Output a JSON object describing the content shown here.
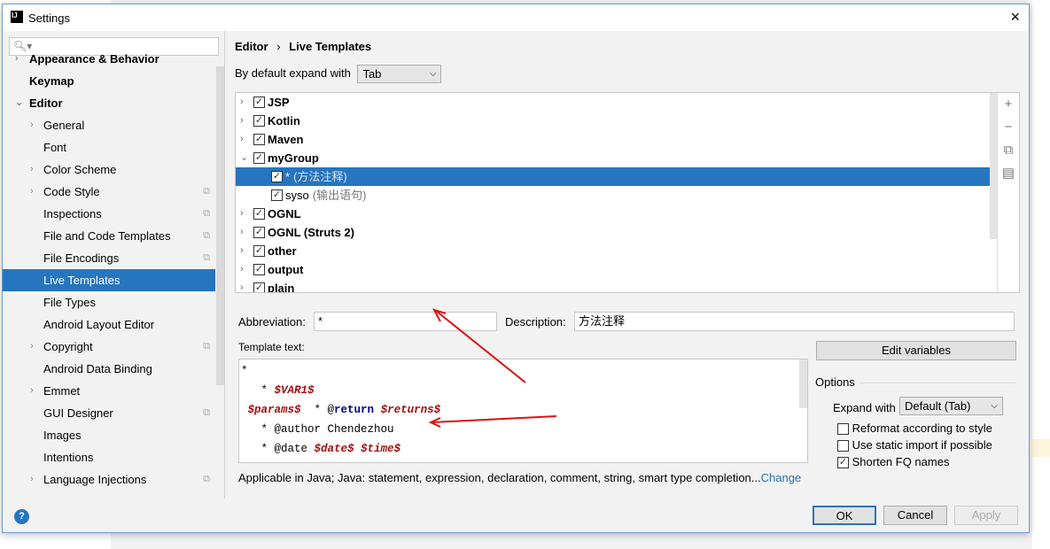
{
  "window": {
    "title": "Settings",
    "close_icon": "×"
  },
  "sidebar": {
    "search_placeholder": "",
    "items": [
      {
        "label": "Appearance & Behavior",
        "bold": true,
        "arrow": "›"
      },
      {
        "label": "Keymap",
        "bold": true
      },
      {
        "label": "Editor",
        "bold": true,
        "arrow": "⌄"
      },
      {
        "label": "General",
        "arrow": "›"
      },
      {
        "label": "Font"
      },
      {
        "label": "Color Scheme",
        "arrow": "›"
      },
      {
        "label": "Code Style",
        "arrow": "›",
        "copy": true
      },
      {
        "label": "Inspections",
        "copy": true
      },
      {
        "label": "File and Code Templates",
        "copy": true
      },
      {
        "label": "File Encodings",
        "copy": true
      },
      {
        "label": "Live Templates",
        "selected": true
      },
      {
        "label": "File Types"
      },
      {
        "label": "Android Layout Editor"
      },
      {
        "label": "Copyright",
        "arrow": "›",
        "copy": true
      },
      {
        "label": "Android Data Binding"
      },
      {
        "label": "Emmet",
        "arrow": "›"
      },
      {
        "label": "GUI Designer",
        "copy": true
      },
      {
        "label": "Images"
      },
      {
        "label": "Intentions"
      },
      {
        "label": "Language Injections",
        "arrow": "›",
        "copy": true
      }
    ]
  },
  "breadcrumb": {
    "parent": "Editor",
    "sep": "›",
    "current": "Live Templates"
  },
  "expand": {
    "label": "By default expand with",
    "value": "Tab"
  },
  "tree": [
    {
      "label": "JSP",
      "checked": true,
      "group": true,
      "expanded": false
    },
    {
      "label": "Kotlin",
      "checked": true,
      "group": true,
      "expanded": false
    },
    {
      "label": "Maven",
      "checked": true,
      "group": true,
      "expanded": false
    },
    {
      "label": "myGroup",
      "checked": true,
      "group": true,
      "expanded": true
    },
    {
      "label": "*",
      "desc": "(方法注释)",
      "checked": true,
      "selected": true
    },
    {
      "label": "syso",
      "desc": "(输出语句)",
      "checked": true
    },
    {
      "label": "OGNL",
      "checked": true,
      "group": true,
      "expanded": false
    },
    {
      "label": "OGNL (Struts 2)",
      "checked": true,
      "group": true,
      "expanded": false
    },
    {
      "label": "other",
      "checked": true,
      "group": true,
      "expanded": false
    },
    {
      "label": "output",
      "checked": true,
      "group": true,
      "expanded": false
    },
    {
      "label": "plain",
      "checked": true,
      "group": true,
      "expanded": false
    }
  ],
  "tree_tools": [
    "+",
    "−",
    "⧉",
    "▤"
  ],
  "form": {
    "abbreviation_label": "Abbreviation:",
    "abbreviation_value": "*",
    "description_label": "Description:",
    "description_value": "方法注释",
    "template_label": "Template text:",
    "edit_variables": "Edit variables"
  },
  "template": {
    "l1": "*",
    "l2_a": "   * ",
    "l2_var": "$VAR1$",
    "l3_var": " $params$",
    "l3_b": "  * @",
    "l3_kw": "return",
    "l3_c": " ",
    "l3_var2": "$returns$",
    "l4": "   * @author Chendezhou",
    "l5_a": "   * @date ",
    "l5_var": "$date$",
    "l5_b": " ",
    "l5_var2": "$time$"
  },
  "applicable": {
    "text": "Applicable in Java; Java: statement, expression, declaration, comment, string, smart type completion...",
    "link": "Change"
  },
  "options": {
    "title": "Options",
    "expand_label": "Expand with",
    "expand_value": "Default (Tab)",
    "reformat": {
      "label": "Reformat according to style",
      "checked": false
    },
    "static_import": {
      "label": "Use static import if possible",
      "checked": false
    },
    "shorten": {
      "label": "Shorten FQ names",
      "checked": true
    }
  },
  "buttons": {
    "ok": "OK",
    "cancel": "Cancel",
    "apply": "Apply",
    "help": "?"
  },
  "colors": {
    "selection": "#2675bf",
    "variable": "#a01010",
    "keyword": "#000080",
    "annotation_arrow": "#e01010"
  }
}
